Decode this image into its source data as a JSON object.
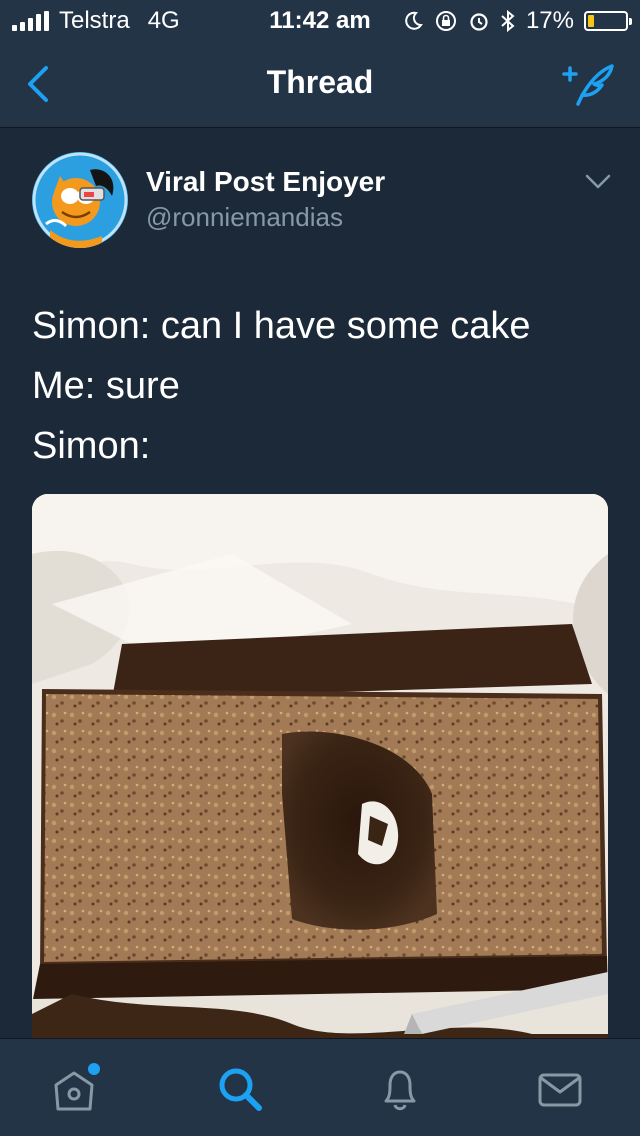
{
  "status_bar": {
    "carrier": "Telstra",
    "network": "4G",
    "time": "11:42 am",
    "battery_percent": "17%",
    "battery_level": 0.17,
    "battery_color": "#f5c518"
  },
  "nav": {
    "title": "Thread",
    "back_icon": "chevron-left-icon",
    "compose_icon": "compose-tweet-icon",
    "accent": "#1da1f2"
  },
  "tweet": {
    "author_name": "Viral Post Enjoyer",
    "author_handle": "@ronniemandias",
    "lines": [
      "Simon: can I have some cake",
      "Me: sure",
      "Simon:"
    ],
    "media": "photo of a chocolate cake with a rectangular hole dug out of the middle"
  },
  "tabbar": {
    "tabs": [
      {
        "name": "home",
        "icon": "home-icon",
        "active": false,
        "has_notification_dot": true
      },
      {
        "name": "search",
        "icon": "search-icon",
        "active": true
      },
      {
        "name": "notifications",
        "icon": "bell-icon",
        "active": false
      },
      {
        "name": "messages",
        "icon": "mail-icon",
        "active": false
      }
    ]
  },
  "colors": {
    "background": "#1c2938",
    "bars": "#243447",
    "secondary_text": "#8899a6",
    "accent": "#1da1f2"
  }
}
